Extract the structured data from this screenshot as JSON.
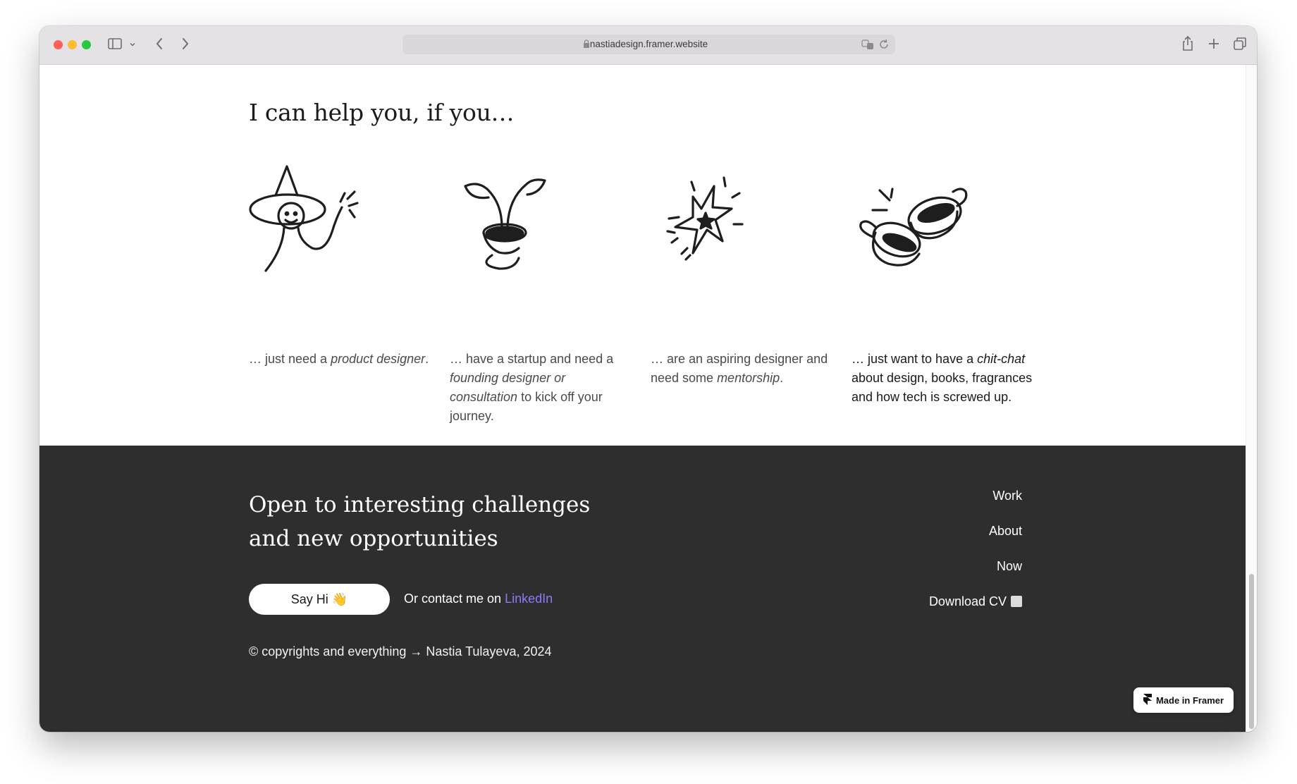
{
  "browser": {
    "url": "nastiadesign.framer.website"
  },
  "help": {
    "heading": "I can help you, if you…",
    "cards": [
      {
        "icon": "wizard-icon",
        "pre": "… just need a ",
        "em": "product designer",
        "post": "."
      },
      {
        "icon": "sprout-icon",
        "pre": "… have a startup and need a ",
        "em": "founding designer or consultation",
        "post": " to kick off your journey."
      },
      {
        "icon": "sparkle-star-icon",
        "pre": "… are an aspiring designer and need some ",
        "em": "mentorship",
        "post": "."
      },
      {
        "icon": "coffee-cups-icon",
        "pre": "… just want to have a ",
        "em": "chit-chat",
        "post": " about design, books, fragrances and how tech is screwed up."
      }
    ]
  },
  "footer": {
    "title_line1": "Open to interesting challenges",
    "title_line2": "and new opportunities",
    "say_hi": "Say Hi 👋",
    "contact_prefix": "Or contact me on ",
    "contact_link": "LinkedIn",
    "copyright": "© copyrights and everything → Nastia Tulayeva, 2024",
    "nav": [
      "Work",
      "About",
      "Now",
      "Download CV"
    ],
    "badge": "Made in Framer"
  },
  "colors": {
    "footer_bg": "#2e2e2e",
    "link_accent": "#8b7cf6"
  }
}
